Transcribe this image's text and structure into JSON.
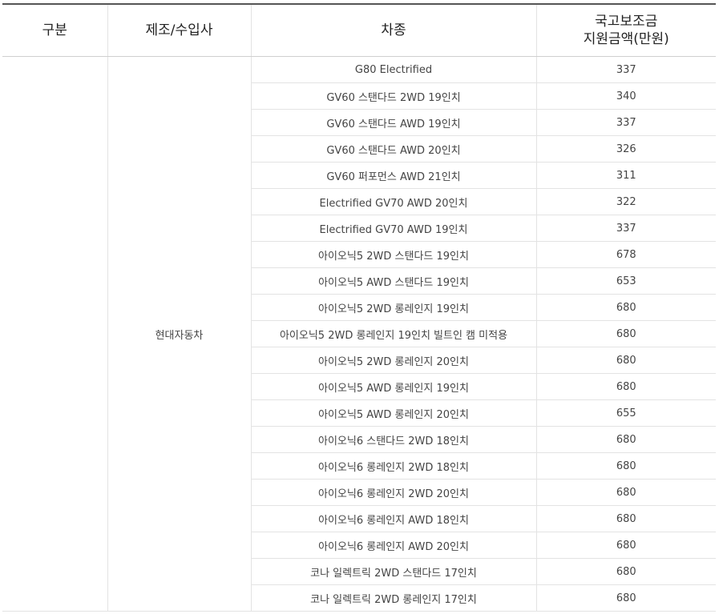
{
  "headers": {
    "category": "구분",
    "maker": "제조/수입사",
    "model": "차종",
    "subsidy_line1": "국고보조금",
    "subsidy_line2": "지원금액(만원)"
  },
  "group": {
    "category": "",
    "maker": "현대자동차"
  },
  "rows": [
    {
      "model": "G80 Electrified",
      "amount": "337"
    },
    {
      "model": "GV60 스탠다드 2WD 19인치",
      "amount": "340"
    },
    {
      "model": "GV60 스탠다드 AWD 19인치",
      "amount": "337"
    },
    {
      "model": "GV60 스탠다드 AWD 20인치",
      "amount": "326"
    },
    {
      "model": "GV60 퍼포먼스 AWD 21인치",
      "amount": "311"
    },
    {
      "model": "Electrified GV70 AWD 20인치",
      "amount": "322"
    },
    {
      "model": "Electrified GV70 AWD 19인치",
      "amount": "337"
    },
    {
      "model": "아이오닉5 2WD 스탠다드 19인치",
      "amount": "678"
    },
    {
      "model": "아이오닉5 AWD 스탠다드 19인치",
      "amount": "653"
    },
    {
      "model": "아이오닉5 2WD 롱레인지 19인치",
      "amount": "680"
    },
    {
      "model": "아이오닉5 2WD 롱레인지 19인치 빌트인 캠 미적용",
      "amount": "680"
    },
    {
      "model": "아이오닉5 2WD 롱레인지 20인치",
      "amount": "680"
    },
    {
      "model": "아이오닉5 AWD 롱레인지 19인치",
      "amount": "680"
    },
    {
      "model": "아이오닉5 AWD 롱레인지 20인치",
      "amount": "655"
    },
    {
      "model": "아이오닉6 스탠다드 2WD 18인치",
      "amount": "680"
    },
    {
      "model": "아이오닉6 롱레인지 2WD 18인치",
      "amount": "680"
    },
    {
      "model": "아이오닉6 롱레인지 2WD 20인치",
      "amount": "680"
    },
    {
      "model": "아이오닉6 롱레인지 AWD 18인치",
      "amount": "680"
    },
    {
      "model": "아이오닉6 롱레인지 AWD 20인치",
      "amount": "680"
    },
    {
      "model": "코나 일렉트릭 2WD 스탠다드 17인치",
      "amount": "680"
    },
    {
      "model": "코나 일렉트릭 2WD 롱레인지 17인치",
      "amount": "680"
    }
  ]
}
